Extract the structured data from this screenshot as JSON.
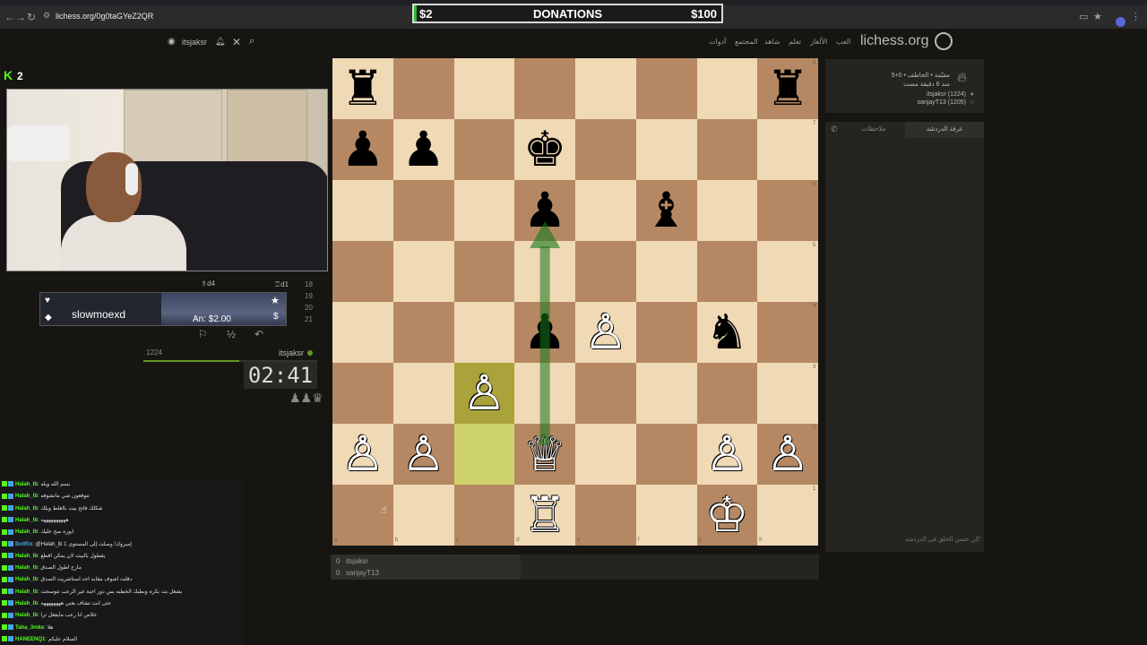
{
  "browser": {
    "url": "lichess.org/0g0taGYeZ2QR",
    "icons": [
      "back-icon",
      "forward-icon",
      "reload-icon",
      "cast-icon",
      "star-icon",
      "extensions-icon"
    ]
  },
  "donations": {
    "min": "$2",
    "title": "DONATIONS",
    "max": "$100",
    "progress_percent": 1
  },
  "header": {
    "logo": "lichess.org",
    "nav": [
      "العب",
      "الألغاز",
      "تعلم",
      "شاهد",
      "المجتمع",
      "أدوات"
    ],
    "username": "itsjaksr"
  },
  "stream": {
    "viewer_count": "2"
  },
  "alert": {
    "username": "slowmoexd",
    "amount": "An: $2.00"
  },
  "moves": {
    "rows": [
      {
        "num": "18",
        "white": "♖d1",
        "black": ""
      },
      {
        "num": "19",
        "white": "",
        "black": ""
      },
      {
        "num": "20",
        "white": "",
        "black": ""
      },
      {
        "num": "21",
        "white": "",
        "black": ""
      }
    ],
    "partial": "♗d4"
  },
  "player_bottom": {
    "name": "itsjaksr",
    "rating": "1224",
    "clock": "02:41",
    "clock_fraction": 0.55
  },
  "chat": [
    {
      "user": "Halah_lb",
      "msg": ": بسم الله ويله",
      "bot": false
    },
    {
      "user": "Halah_lb",
      "msg": ": تتوقعون شي ماتشوفه",
      "bot": false
    },
    {
      "user": "Halah_lb",
      "msg": ": شكلك فاتح بيت بالغلط ويلك",
      "bot": false
    },
    {
      "user": "Halah_lb",
      "msg": ": ههههههههههه",
      "bot": false
    },
    {
      "user": "Halah_lb",
      "msg": ": ابوره صح عليك",
      "bot": false
    },
    {
      "user": "BotRix",
      "msg": ": @Halah_lb إمبروك! وصلت إلى المستوى 1",
      "bot": true
    },
    {
      "user": "Halah_lb",
      "msg": ": يقطول بالبيت لان يمكن اقطع",
      "bot": false
    },
    {
      "user": "Halah_lb",
      "msg": ": مارح اطول الصدق",
      "bot": false
    },
    {
      "user": "Halah_lb",
      "msg": ": دقلت اشوف مقابه احد استاشريت الصدق",
      "bot": false
    },
    {
      "user": "Halah_lb",
      "msg": ": بشغل بت بكره وبطيك الخطبه بس دور اجبة غير الرعب تتوسحت",
      "bot": false
    },
    {
      "user": "Halah_lb",
      "msg": ": حتى انت تشاف يعني ههههههههه",
      "bot": false
    },
    {
      "user": "Halah_lb",
      "msg": ": خلاص انا رعب مايفغل ترا",
      "bot": false
    },
    {
      "user": "Taha_3mke",
      "msg": ": هلا",
      "bot": false
    },
    {
      "user": "HANEENQ1",
      "msg": ": السلام عليكم",
      "bot": false
    }
  ],
  "board": {
    "pieces": [
      {
        "sq": "a8",
        "p": "♜",
        "c": "b"
      },
      {
        "sq": "h8",
        "p": "♜",
        "c": "b"
      },
      {
        "sq": "a7",
        "p": "♟",
        "c": "b"
      },
      {
        "sq": "b7",
        "p": "♟",
        "c": "b"
      },
      {
        "sq": "d7",
        "p": "♚",
        "c": "b"
      },
      {
        "sq": "d6",
        "p": "♟",
        "c": "b"
      },
      {
        "sq": "f6",
        "p": "♝",
        "c": "b"
      },
      {
        "sq": "d4",
        "p": "♟",
        "c": "b"
      },
      {
        "sq": "e4",
        "p": "♙",
        "c": "w"
      },
      {
        "sq": "g4",
        "p": "♞",
        "c": "b"
      },
      {
        "sq": "c3",
        "p": "♙",
        "c": "w"
      },
      {
        "sq": "a2",
        "p": "♙",
        "c": "w"
      },
      {
        "sq": "b2",
        "p": "♙",
        "c": "w"
      },
      {
        "sq": "d2",
        "p": "♕",
        "c": "w"
      },
      {
        "sq": "g2",
        "p": "♙",
        "c": "w"
      },
      {
        "sq": "h2",
        "p": "♙",
        "c": "w"
      },
      {
        "sq": "d1",
        "p": "♖",
        "c": "w"
      },
      {
        "sq": "g1",
        "p": "♔",
        "c": "w"
      }
    ],
    "last_move": [
      "c2",
      "c3"
    ],
    "arrow": {
      "from": "d2",
      "to": "d6",
      "color": "#15781b"
    },
    "files": [
      "a",
      "b",
      "c",
      "d",
      "e",
      "f",
      "g",
      "h"
    ],
    "ranks": [
      "1",
      "2",
      "3",
      "4",
      "5",
      "6",
      "7",
      "8"
    ]
  },
  "below_board": {
    "lines": [
      {
        "score": "0",
        "name": "itsjaksr"
      },
      {
        "score": "0",
        "name": "sanjayT13"
      }
    ]
  },
  "game_info": {
    "title": "5+0 • مقيّمة • الخاطف",
    "time_ago": "منذ 6 دقيقة مضت",
    "player1": "itsjaksr (1224)",
    "player2": "sanjayT13 (1205)"
  },
  "chat_panel": {
    "tab_room": "غرفة الدردشة",
    "tab_notes": "ملاحظات",
    "placeholder": "كن حسن الخلق في الدردشة!"
  },
  "colors": {
    "light_square": "#f0d9b5",
    "dark_square": "#b58863",
    "highlight": "#cdd26a",
    "kick_green": "#53fc18"
  }
}
